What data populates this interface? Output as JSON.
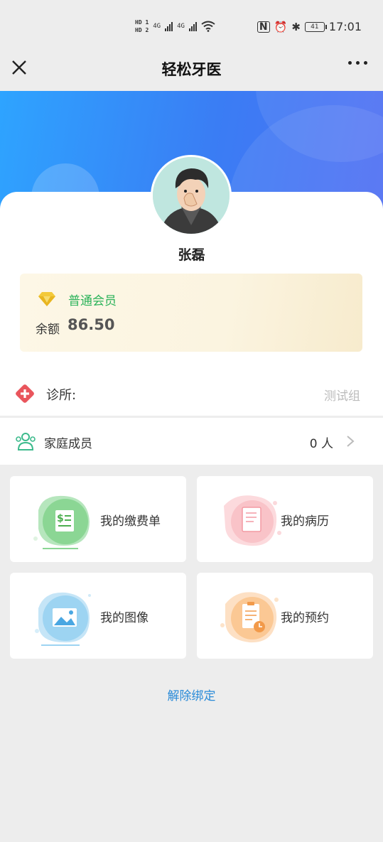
{
  "status_bar": {
    "hd1": "HD 1",
    "hd2": "HD 2",
    "net1": "4G",
    "net2": "4G",
    "battery": "41",
    "time": "17:01"
  },
  "nav": {
    "title": "轻松牙医",
    "close_icon": "close-icon",
    "more_icon": "more-dots-icon"
  },
  "profile": {
    "name": "张磊",
    "member_level": "普通会员",
    "balance_label": "余额",
    "balance_value": "86.50"
  },
  "clinic": {
    "label": "诊所:",
    "value": "测试组"
  },
  "family": {
    "label": "家庭成员",
    "count": "0 人"
  },
  "tiles": [
    {
      "label": "我的缴费单",
      "icon": "bill-icon",
      "color": "#7ed08a"
    },
    {
      "label": "我的病历",
      "icon": "medical-record-icon",
      "color": "#f7a7ae"
    },
    {
      "label": "我的图像",
      "icon": "image-icon",
      "color": "#8fcdf0"
    },
    {
      "label": "我的预约",
      "icon": "appointment-icon",
      "color": "#f9c48f"
    }
  ],
  "unbind": "解除绑定",
  "colors": {
    "accent_blue": "#2a8bd8",
    "member_green": "#2bb35a",
    "hero_start": "#2ea4ff",
    "hero_end": "#4f6ef2"
  }
}
